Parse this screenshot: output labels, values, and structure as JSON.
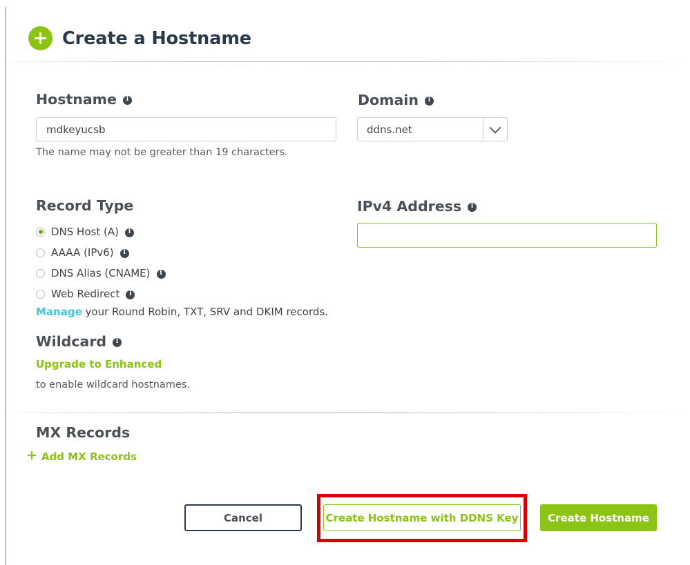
{
  "header": {
    "title": "Create a Hostname",
    "add_icon": "plus-circle-icon"
  },
  "form": {
    "hostname": {
      "label": "Hostname",
      "info_icon": "info-icon",
      "value": "mdkeyucsb",
      "placeholder": "",
      "helper": "The name may not be greater than 19 characters."
    },
    "domain": {
      "label": "Domain",
      "info_icon": "info-icon",
      "selected": "ddns.net",
      "chevron_icon": "chevron-down-icon"
    },
    "record_type": {
      "label": "Record Type",
      "options": [
        {
          "label": "DNS Host (A)",
          "selected": true,
          "info_icon": "info-icon"
        },
        {
          "label": "AAAA (IPv6)",
          "selected": false,
          "info_icon": "info-icon"
        },
        {
          "label": "DNS Alias (CNAME)",
          "selected": false,
          "info_icon": "info-icon"
        },
        {
          "label": "Web Redirect",
          "selected": false,
          "info_icon": "info-icon"
        }
      ],
      "manage_link": "Manage",
      "manage_rest": " your Round Robin, TXT, SRV and DKIM records."
    },
    "ipv4": {
      "label": "IPv4 Address",
      "info_icon": "info-icon",
      "value": "",
      "placeholder": ""
    },
    "wildcard": {
      "label": "Wildcard",
      "info_icon": "info-icon",
      "upgrade_link": "Upgrade to Enhanced",
      "helper": "to enable wildcard hostnames."
    },
    "mx_records": {
      "label": "MX Records",
      "add_link": "Add MX Records",
      "add_icon": "plus-icon"
    }
  },
  "footer": {
    "cancel_label": "Cancel",
    "ddns_label": "Create Hostname with DDNS Key",
    "create_label": "Create Hostname"
  },
  "colors": {
    "brand_green": "#8cc413",
    "link_cyan": "#3ec6dd",
    "navy": "#2b3a4a",
    "highlight_red": "#d50000"
  }
}
